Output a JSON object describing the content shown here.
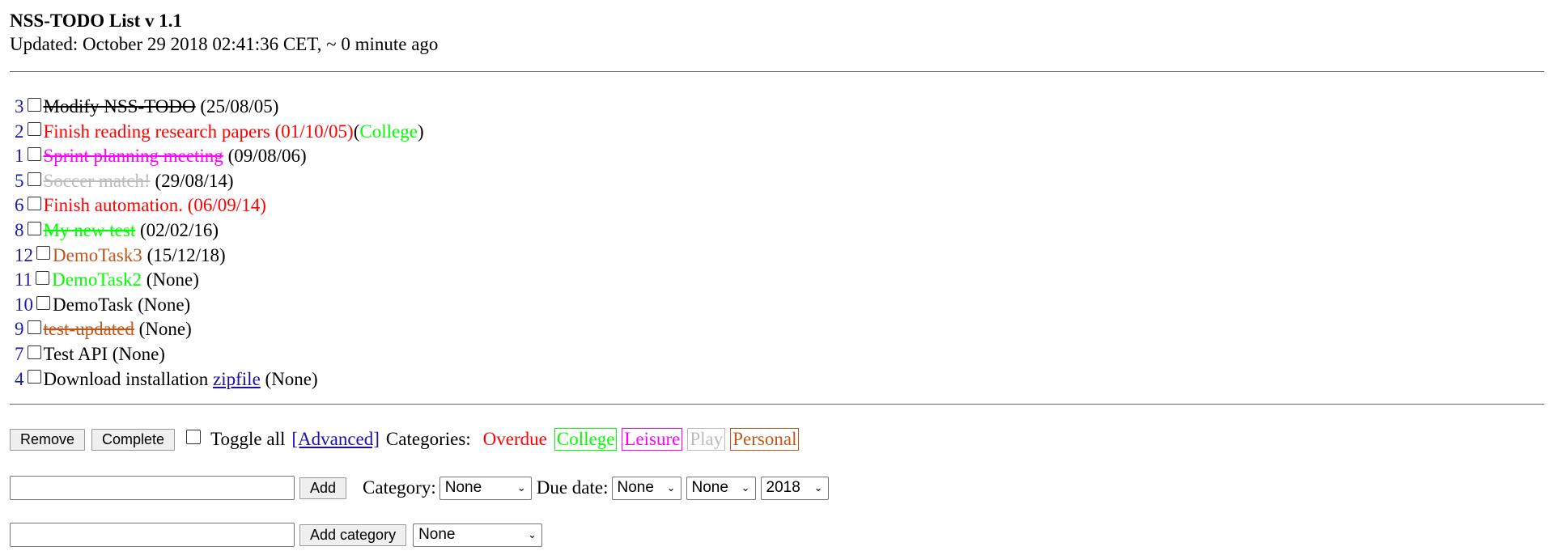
{
  "header": {
    "title": "NSS-TODO List v 1.1",
    "updated": "Updated: October 29 2018 02:41:36 CET, ~ 0 minute ago"
  },
  "colors": {
    "overdue": "#ff0000",
    "college": "#00ff00",
    "leisure": "#ff00ff",
    "play": "#bbbbbb",
    "personal": "#c0561a",
    "number": "#1a1aa6",
    "link": "#1a0dab"
  },
  "tasks": [
    {
      "id": "3",
      "title": "Modify NSS-TODO",
      "due": "(25/08/05)",
      "color": "#000000",
      "done": true
    },
    {
      "id": "2",
      "title": "Finish reading research papers (01/10/05)",
      "due": "",
      "color": "#ff0000",
      "done": false,
      "category_open": "(",
      "category": "College",
      "category_color": "#00ff00",
      "category_close": ")"
    },
    {
      "id": "1",
      "title": "Sprint planning meeting",
      "due": "(09/08/06)",
      "color": "#ff00ff",
      "done": true
    },
    {
      "id": "5",
      "title": "Soccer match!",
      "due": "(29/08/14)",
      "color": "#bbbbbb",
      "done": true
    },
    {
      "id": "6",
      "title": "Finish automation. (06/09/14)",
      "due": "",
      "color": "#ff0000",
      "done": false
    },
    {
      "id": "8",
      "title": "My new test",
      "due": "(02/02/16)",
      "color": "#00ff00",
      "done": true
    },
    {
      "id": "12",
      "title": "DemoTask3",
      "due": "(15/12/18)",
      "color": "#c0561a",
      "done": false
    },
    {
      "id": "11",
      "title": "DemoTask2",
      "due": "(None)",
      "color": "#00ff00",
      "done": false
    },
    {
      "id": "10",
      "title": "DemoTask",
      "due": "(None)",
      "color": "#000000",
      "done": false
    },
    {
      "id": "9",
      "title": "test-updated",
      "due": "(None)",
      "color": "#c0561a",
      "done": true
    },
    {
      "id": "7",
      "title": "Test API",
      "due": "(None)",
      "color": "#000000",
      "done": false
    },
    {
      "id": "4",
      "title": "Download installation",
      "link_text": "zipfile",
      "due": "(None)",
      "color": "#000000",
      "done": false
    }
  ],
  "controls": {
    "remove_label": "Remove",
    "complete_label": "Complete",
    "toggle_all_label": "Toggle all",
    "advanced_label": "[Advanced]",
    "categories_label": "Categories:",
    "categories": [
      {
        "name": "Overdue",
        "color": "#ff0000",
        "bordered": false
      },
      {
        "name": "College",
        "color": "#00ff00",
        "bordered": true
      },
      {
        "name": "Leisure",
        "color": "#ff00ff",
        "bordered": true
      },
      {
        "name": "Play",
        "color": "#bbbbbb",
        "bordered": true
      },
      {
        "name": "Personal",
        "color": "#c0561a",
        "bordered": true
      }
    ]
  },
  "add_task": {
    "input_value": "",
    "add_label": "Add",
    "category_label": "Category:",
    "category_selected": "None",
    "due_label": "Due date:",
    "day_selected": "None",
    "month_selected": "None",
    "year_selected": "2018"
  },
  "add_category": {
    "input_value": "",
    "add_label": "Add category",
    "color_selected": "None"
  }
}
